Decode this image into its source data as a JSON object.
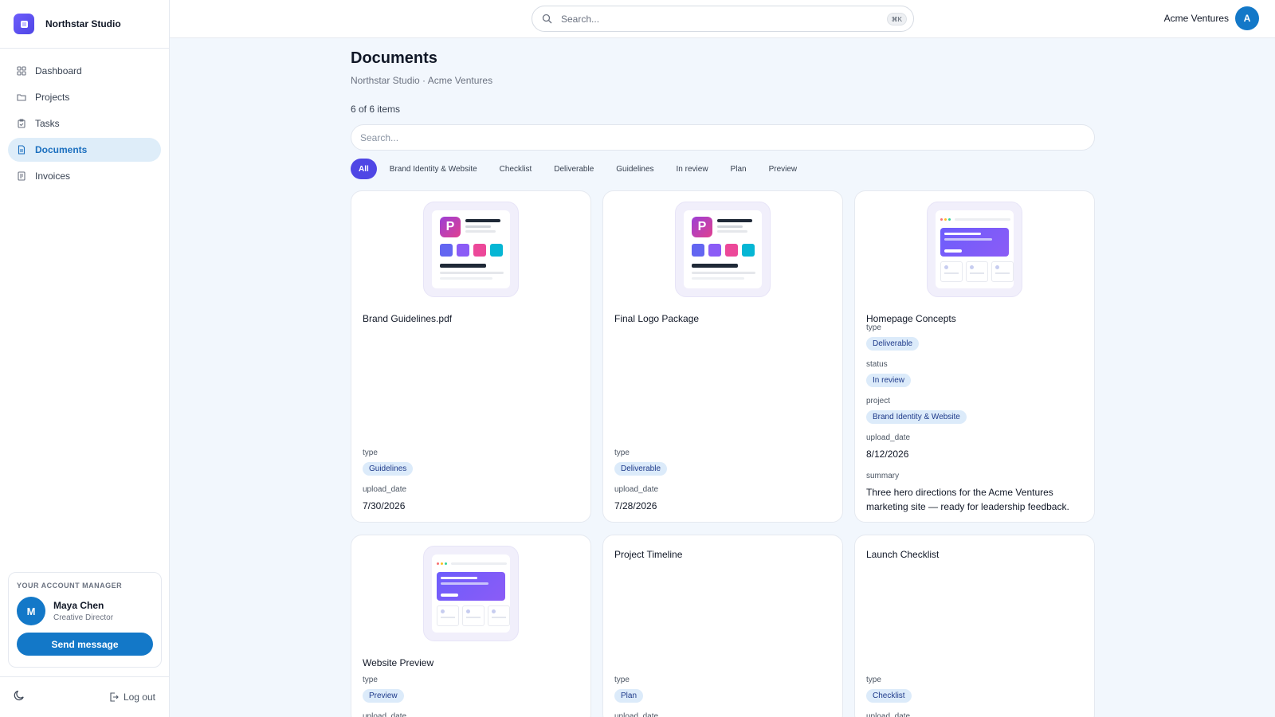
{
  "brand": {
    "name": "Northstar Studio"
  },
  "nav": [
    {
      "label": "Dashboard",
      "icon": "dashboard-icon",
      "active": false
    },
    {
      "label": "Projects",
      "icon": "folder-icon",
      "active": false
    },
    {
      "label": "Tasks",
      "icon": "clipboard-icon",
      "active": false
    },
    {
      "label": "Documents",
      "icon": "document-icon",
      "active": true
    },
    {
      "label": "Invoices",
      "icon": "invoice-icon",
      "active": false
    }
  ],
  "manager": {
    "label": "YOUR ACCOUNT MANAGER",
    "initial": "M",
    "name": "Maya Chen",
    "role": "Creative Director",
    "button": "Send message"
  },
  "footer": {
    "logout": "Log out"
  },
  "topbar": {
    "search_placeholder": "Search...",
    "shortcut": "⌘K",
    "account_name": "Acme Ventures",
    "account_initial": "A"
  },
  "page": {
    "title": "Documents",
    "breadcrumb": "Northstar Studio · Acme Ventures",
    "count": "6 of 6 items",
    "search_placeholder": "Search..."
  },
  "filters": [
    "All",
    "Brand Identity & Website",
    "Checklist",
    "Deliverable",
    "Guidelines",
    "In review",
    "Plan",
    "Preview"
  ],
  "colors": {
    "accent": "#4f46e5",
    "primary": "#1378c8",
    "badge_bg": "#dcebfa"
  },
  "cards": [
    {
      "title": "Brand Guidelines.pdf",
      "thumb": "brand",
      "fields": [
        {
          "label": "type",
          "badge": "Guidelines"
        },
        {
          "label": "upload_date",
          "value": "7/30/2026"
        }
      ]
    },
    {
      "title": "Final Logo Package",
      "thumb": "brand",
      "fields": [
        {
          "label": "type",
          "badge": "Deliverable"
        },
        {
          "label": "upload_date",
          "value": "7/28/2026"
        }
      ]
    },
    {
      "title": "Homepage Concepts",
      "thumb": "web",
      "fields": [
        {
          "label": "type",
          "badge": "Deliverable"
        },
        {
          "label": "status",
          "badge": "In review"
        },
        {
          "label": "project",
          "badge": "Brand Identity & Website"
        },
        {
          "label": "upload_date",
          "value": "8/12/2026"
        },
        {
          "label": "summary",
          "value": "Three hero directions for the Acme Ventures marketing site — ready for leadership feedback."
        }
      ]
    },
    {
      "title": "Website Preview",
      "thumb": "web",
      "fields": [
        {
          "label": "type",
          "badge": "Preview"
        },
        {
          "label": "upload_date",
          "value": ""
        }
      ]
    },
    {
      "title": "Project Timeline",
      "thumb": "",
      "fields": [
        {
          "label": "type",
          "badge": "Plan"
        },
        {
          "label": "upload_date",
          "value": ""
        }
      ]
    },
    {
      "title": "Launch Checklist",
      "thumb": "",
      "fields": [
        {
          "label": "type",
          "badge": "Checklist"
        },
        {
          "label": "upload_date",
          "value": ""
        }
      ]
    }
  ]
}
